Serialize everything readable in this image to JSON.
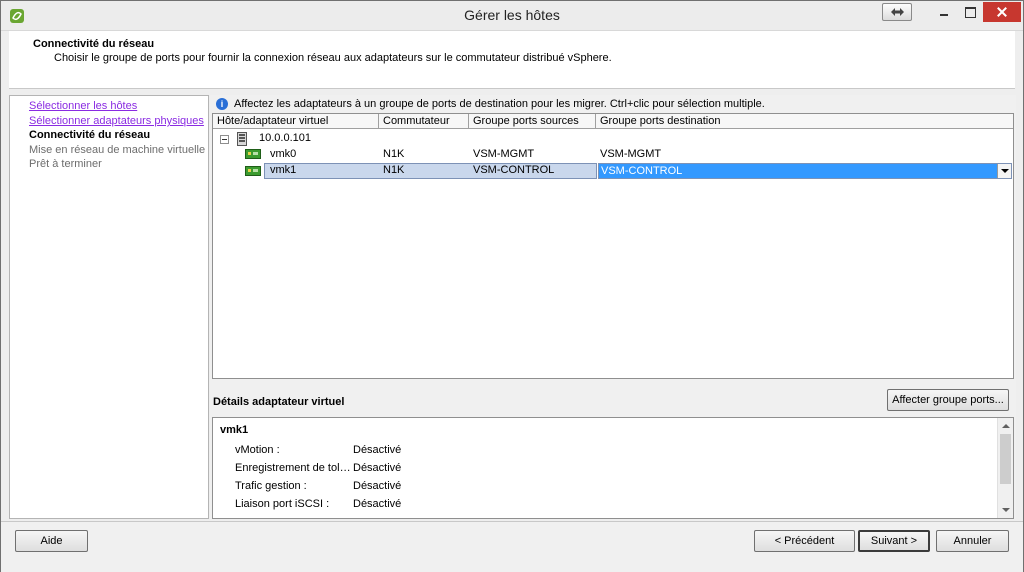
{
  "window": {
    "title": "Gérer les hôtes"
  },
  "header": {
    "title": "Connectivité du réseau",
    "description": "Choisir le groupe de ports pour fournir la connexion réseau aux adaptateurs sur le commutateur distribué vSphere."
  },
  "nav": {
    "items": [
      {
        "label": "Sélectionner les hôtes",
        "state": "link"
      },
      {
        "label": "Sélectionner adaptateurs physiques",
        "state": "link"
      },
      {
        "label": "Connectivité du réseau",
        "state": "current"
      },
      {
        "label": "Mise en réseau de machine virtuelle",
        "state": "disabled"
      },
      {
        "label": "Prêt à terminer",
        "state": "disabled"
      }
    ]
  },
  "info": {
    "text": "Affectez les adaptateurs à un groupe de ports de destination pour les migrer. Ctrl+clic pour sélection multiple."
  },
  "grid": {
    "columns": [
      "Hôte/adaptateur virtuel",
      "Commutateur",
      "Groupe ports sources",
      "Groupe ports destination"
    ],
    "host": "10.0.0.101",
    "rows": [
      {
        "adapter": "vmk0",
        "switch": "N1K",
        "source": "VSM-MGMT",
        "destination": "VSM-MGMT"
      },
      {
        "adapter": "vmk1",
        "switch": "N1K",
        "source": "VSM-CONTROL",
        "destination": "VSM-CONTROL"
      }
    ]
  },
  "details": {
    "title": "Détails adaptateur virtuel",
    "assign_button": "Affecter groupe ports...",
    "adapter_name": "vmk1",
    "properties": [
      {
        "label": "vMotion :",
        "value": "Désactivé"
      },
      {
        "label": "Enregistrement de tolé...",
        "value": "Désactivé"
      },
      {
        "label": "Trafic gestion :",
        "value": "Désactivé"
      },
      {
        "label": "Liaison port iSCSI :",
        "value": "Désactivé"
      }
    ]
  },
  "footer": {
    "help": "Aide",
    "previous": "< Précédent",
    "next": "Suivant >",
    "cancel": "Annuler"
  },
  "colors": {
    "selection": "#3399ff",
    "link": "#8a2be2",
    "close": "#c7372f"
  }
}
